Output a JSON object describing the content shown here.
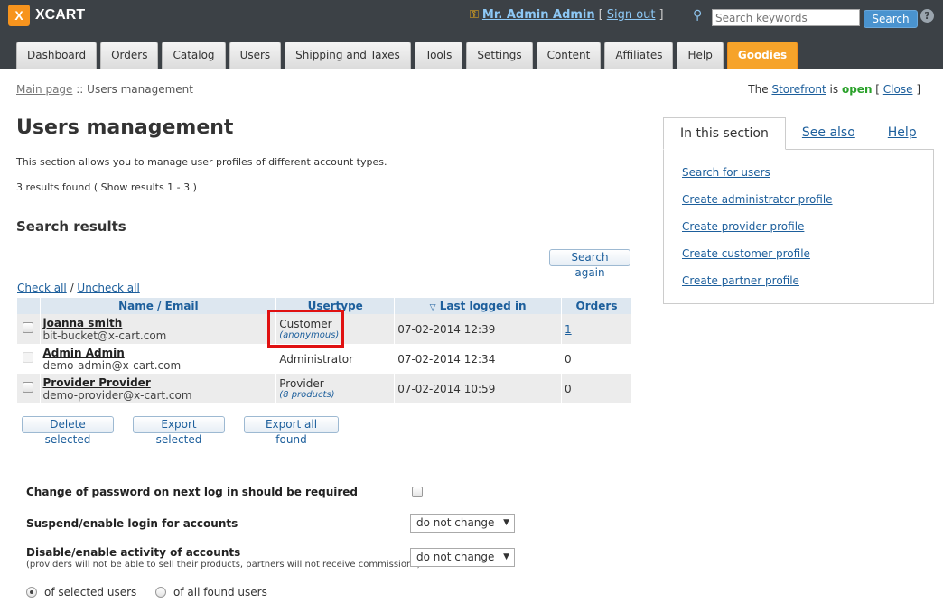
{
  "header": {
    "logo_letter": "X",
    "logo_text": "XCART",
    "user_name": "Mr. Admin Admin",
    "signout_label": "Sign out",
    "search_placeholder": "Search keywords",
    "search_button": "Search",
    "help_icon_label": "?"
  },
  "tabs": [
    "Dashboard",
    "Orders",
    "Catalog",
    "Users",
    "Shipping and Taxes",
    "Tools",
    "Settings",
    "Content",
    "Affiliates",
    "Help",
    "Goodies"
  ],
  "breadcrumb": {
    "home": "Main page",
    "sep": " :: ",
    "current": "Users management"
  },
  "store_status": {
    "prefix": "The",
    "link": "Storefront",
    "middle": "is",
    "state": "open",
    "close": "Close"
  },
  "page": {
    "title": "Users management",
    "description": "This section allows you to manage user profiles of different account types.",
    "results_count": "3 results found ( Show results 1 - 3 )",
    "search_results_heading": "Search results",
    "search_again": "Search again",
    "check_all": "Check all",
    "uncheck_all": "Uncheck all"
  },
  "table": {
    "headers": {
      "name": "Name",
      "email": "Email",
      "usertype": "Usertype",
      "last_login": "Last logged in",
      "orders": "Orders"
    },
    "rows": [
      {
        "name": "joanna smith",
        "email": "bit-bucket@x-cart.com",
        "usertype": "Customer",
        "usertype_sub": "(anonymous)",
        "last_login": "07-02-2014 12:39",
        "orders": "1"
      },
      {
        "name": "Admin Admin",
        "email": "demo-admin@x-cart.com",
        "usertype": "Administrator",
        "usertype_sub": "",
        "last_login": "07-02-2014 12:34",
        "orders": "0"
      },
      {
        "name": "Provider Provider",
        "email": "demo-provider@x-cart.com",
        "usertype": "Provider",
        "usertype_sub": "(8 products)",
        "last_login": "07-02-2014 10:59",
        "orders": "0"
      }
    ]
  },
  "actions": {
    "delete": "Delete selected",
    "export": "Export selected",
    "export_all": "Export all found"
  },
  "side_panel": {
    "tabs": [
      "In this section",
      "See also",
      "Help"
    ],
    "links": [
      "Search for users",
      "Create administrator profile",
      "Create provider profile",
      "Create customer profile",
      "Create partner profile"
    ]
  },
  "form": {
    "password_label": "Change of password on next log in should be required",
    "suspend_label": "Suspend/enable login for accounts",
    "suspend_value": "do not change",
    "activity_label": "Disable/enable activity of accounts",
    "activity_note": "(providers will not be able to sell their products, partners will not receive commissions)",
    "activity_value": "do not change",
    "radio_selected": "of selected users",
    "radio_all": "of all found users"
  }
}
